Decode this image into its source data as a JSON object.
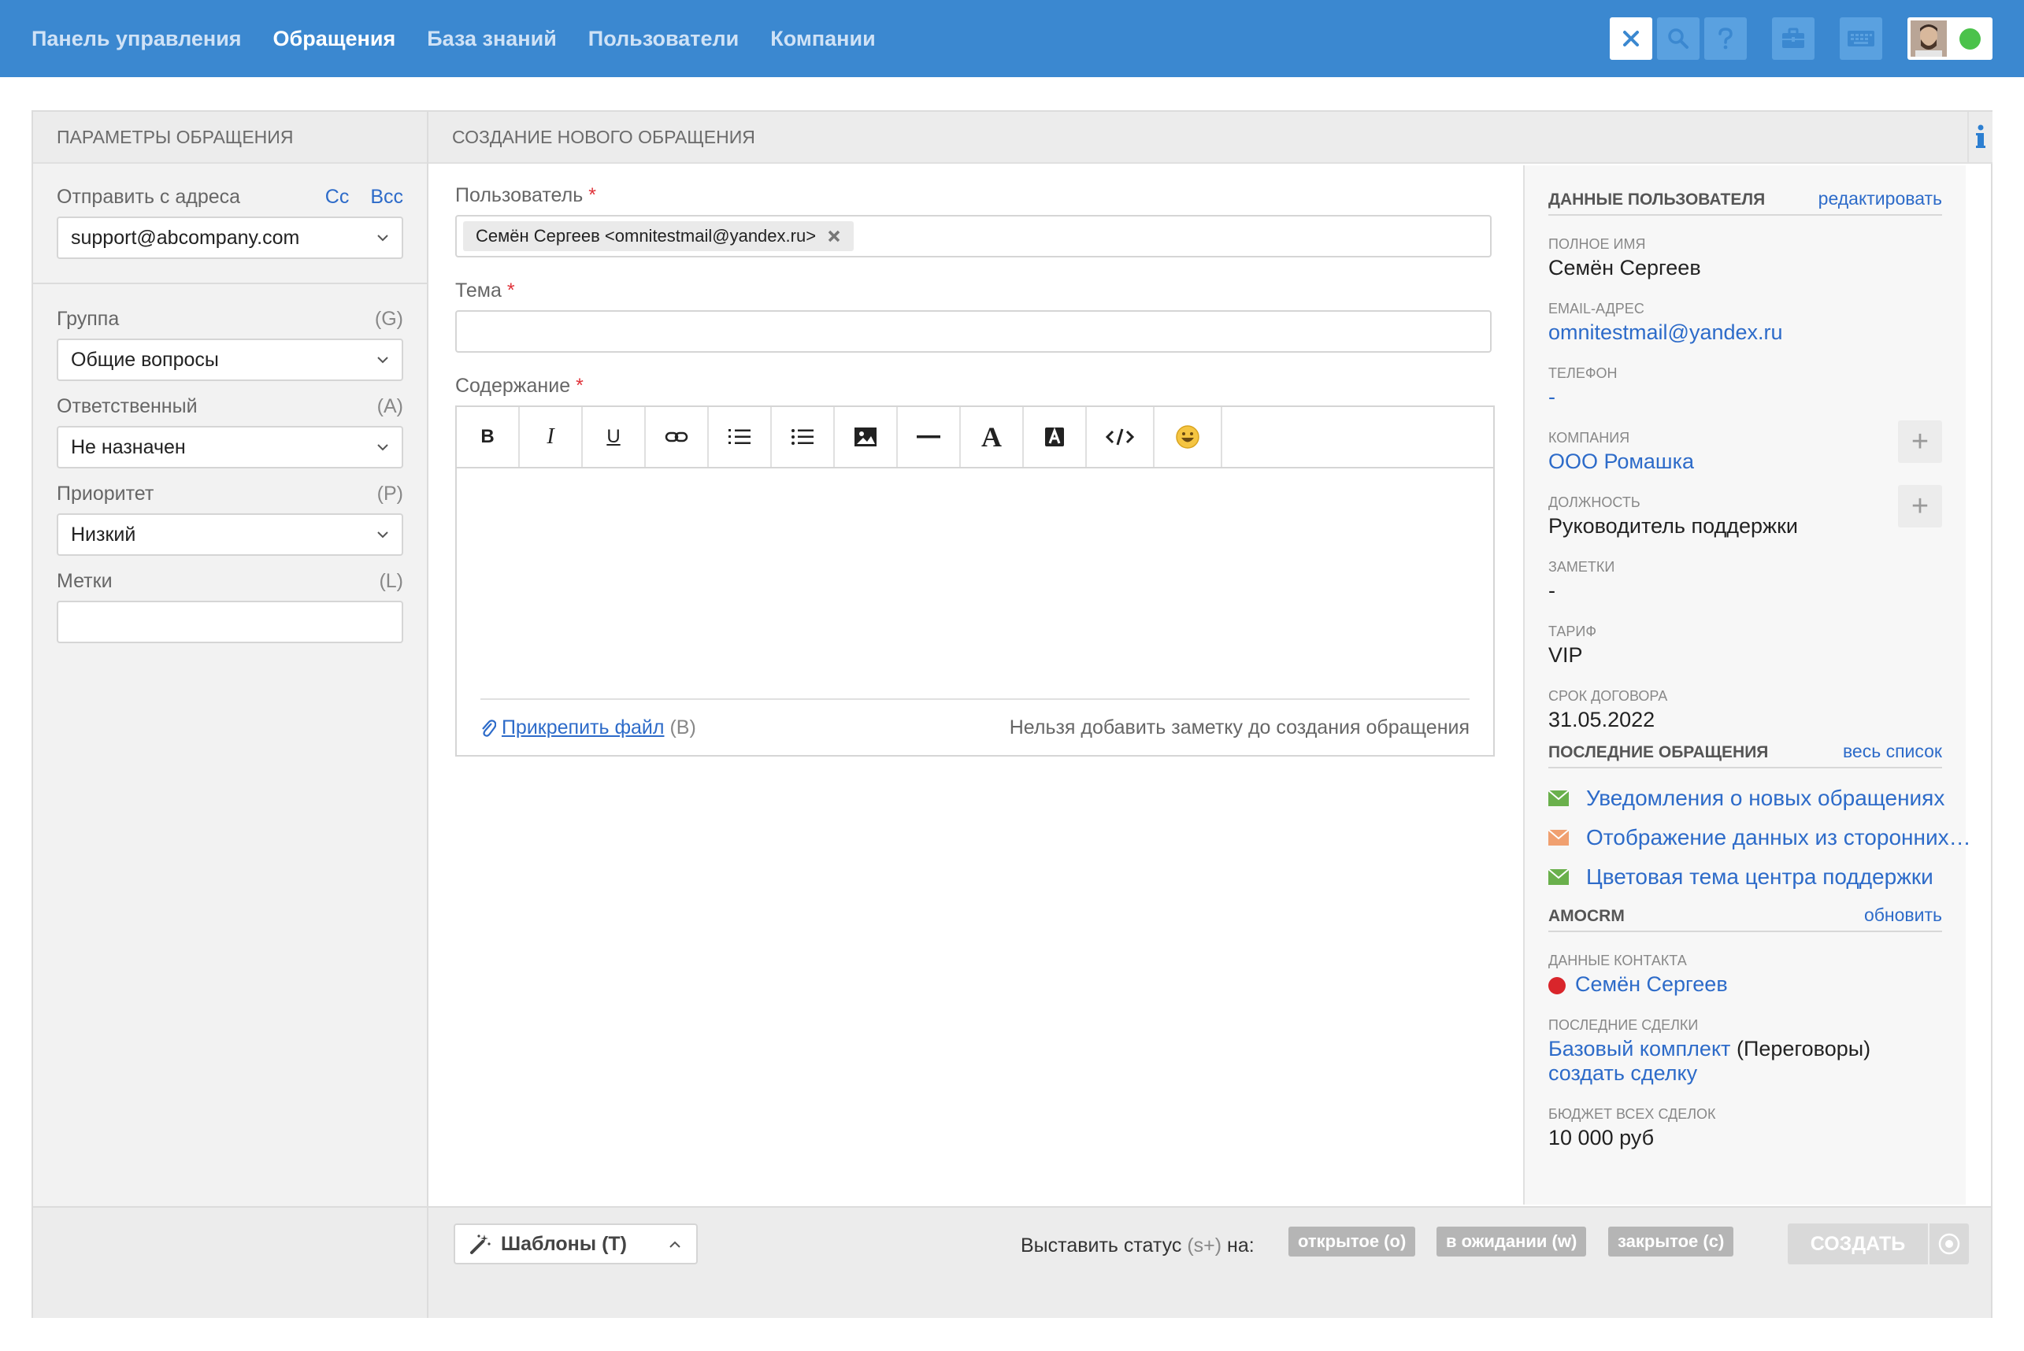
{
  "nav": {
    "items": [
      "Панель управления",
      "Обращения",
      "База знаний",
      "Пользователи",
      "Компании"
    ],
    "active": "Обращения"
  },
  "toolbar_icons": [
    "close-icon",
    "search-icon",
    "help-icon",
    "briefcase-icon",
    "keyboard-icon"
  ],
  "colors": {
    "header": "#3b88d0",
    "link": "#2d6bc9",
    "required": "#e0333a",
    "online": "#4bc24b",
    "green_envelope": "#6ab04c",
    "orange_envelope": "#f0a070"
  },
  "left_panel": {
    "title": "ПАРАМЕТРЫ ОБРАЩЕНИЯ",
    "from_label": "Отправить с адреса",
    "cc": "Cc",
    "bcc": "Bcc",
    "from_value": "support@abcompany.com",
    "group_label": "Группа",
    "group_hot": "(G)",
    "group_value": "Общие вопросы",
    "assignee_label": "Ответственный",
    "assignee_hot": "(A)",
    "assignee_value": "Не назначен",
    "priority_label": "Приоритет",
    "priority_hot": "(P)",
    "priority_value": "Низкий",
    "tags_label": "Метки",
    "tags_hot": "(L)",
    "tags_value": ""
  },
  "center": {
    "title": "СОЗДАНИЕ НОВОГО ОБРАЩЕНИЯ",
    "user_label": "Пользователь",
    "required_mark": "*",
    "user_tag": "Семён Сергеев <omnitestmail@yandex.ru>",
    "subject_label": "Тема",
    "subject_value": "",
    "content_label": "Содержание",
    "editor_tools": [
      "bold-icon",
      "italic-icon",
      "underline-icon",
      "link-icon",
      "numbered-list-icon",
      "bullet-list-icon",
      "image-icon",
      "horizontal-rule-icon",
      "font-color-icon",
      "font-background-icon",
      "code-icon",
      "emoji-icon"
    ],
    "bold_glyph": "B",
    "italic_glyph": "I",
    "underline_glyph": "U",
    "font_glyph": "A",
    "attach_label": "Прикрепить файл",
    "attach_hot": "(B)",
    "note_disabled": "Нельзя добавить заметку до создания обращения"
  },
  "user_data": {
    "title": "ДАННЫЕ ПОЛЬЗОВАТЕЛЯ",
    "edit_link": "редактировать",
    "fields": [
      {
        "caption": "ПОЛНОЕ ИМЯ",
        "value": "Семён Сергеев"
      },
      {
        "caption": "EMAIL-АДРЕС",
        "value": "omnitestmail@yandex.ru"
      },
      {
        "caption": "ТЕЛЕФОН",
        "value": "-"
      },
      {
        "caption": "КОМПАНИЯ",
        "value": "ООО Ромашка"
      },
      {
        "caption": "ДОЛЖНОСТЬ",
        "value": "Руководитель поддержки"
      },
      {
        "caption": "ЗАМЕТКИ",
        "value": "-"
      },
      {
        "caption": "ТАРИФ",
        "value": "VIP"
      },
      {
        "caption": "СРОК ДОГОВОРА",
        "value": "31.05.2022"
      }
    ],
    "plus_glyph": "+"
  },
  "recent_tickets": {
    "title": "ПОСЛЕДНИЕ ОБРАЩЕНИЯ",
    "all_link": "весь список",
    "items": [
      {
        "title": "Уведомления о новых обращениях",
        "color": "#6ab04c"
      },
      {
        "title": "Отображение данных из сторонних…",
        "color": "#f0a070"
      },
      {
        "title": "Цветовая тема центра поддержки",
        "color": "#6ab04c"
      }
    ]
  },
  "amocrm": {
    "title": "AMOCRM",
    "refresh_link": "обновить",
    "contact_caption": "ДАННЫЕ КОНТАКТА",
    "contact_name": "Семён Сергеев",
    "deals_caption": "ПОСЛЕДНИЕ СДЕЛКИ",
    "deal_name": "Базовый комплект",
    "deal_stage": "(Переговоры)",
    "create_deal": "создать сделку",
    "budget_caption": "БЮДЖЕТ ВСЕХ СДЕЛОК",
    "budget_value": "10 000 руб"
  },
  "bottom_bar": {
    "templates_label": "Шаблоны (T)",
    "status_label": "Выставить статус",
    "status_hot": "(s+)",
    "status_suffix": "на:",
    "statuses": [
      "открытое (o)",
      "в ожидании (w)",
      "закрытое (c)"
    ],
    "create_label": "СОЗДАТЬ"
  }
}
